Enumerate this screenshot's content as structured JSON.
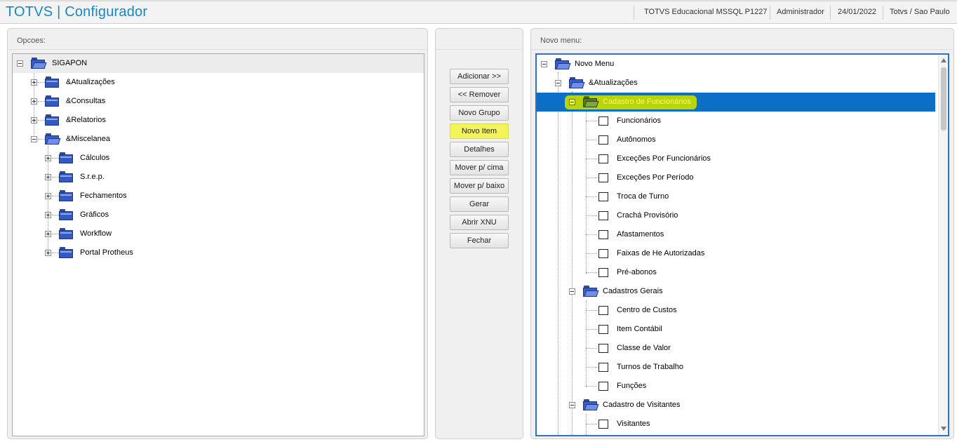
{
  "header": {
    "title": "TOTVS | Configurador",
    "environment": "TOTVS Educacional MSSQL P1227",
    "user": "Administrador",
    "date": "24/01/2022",
    "branch": "Totvs / Sao Paulo"
  },
  "left_panel": {
    "title": "Opcoes:",
    "root": "SIGAPON",
    "items": [
      "&Atualizações",
      "&Consultas",
      "&Relatorios",
      "&Miscelanea"
    ],
    "misc_children": [
      "Cálculos",
      "S.r.e.p.",
      "Fechamentos",
      "Gráficos",
      "Workflow",
      "Portal Protheus"
    ]
  },
  "buttons": {
    "adicionar": "Adicionar >>",
    "remover": "<< Remover",
    "novo_grupo": "Novo Grupo",
    "novo_item": "Novo Item",
    "detalhes": "Detalhes",
    "mover_cima": "Mover p/ cima",
    "mover_baixo": "Mover p/ baixo",
    "gerar": "Gerar",
    "abrir_xnu": "Abrir XNU",
    "fechar": "Fechar"
  },
  "right_panel": {
    "title": "Novo menu:",
    "root": "Novo Menu",
    "atualizacoes": "&Atualizações",
    "group1": {
      "label": "Cadastro de Funcionários",
      "items": [
        "Funcionários",
        "Autônomos",
        "Exceções Por Funcionários",
        "Exceções Por Período",
        "Troca de Turno",
        "Crachá Provisório",
        "Afastamentos",
        "Faixas de He Autorizadas",
        "Pré-abonos"
      ]
    },
    "group2": {
      "label": "Cadastros Gerais",
      "items": [
        "Centro de Custos",
        "Item Contábil",
        "Classe de Valor",
        "Turnos de Trabalho",
        "Funções"
      ]
    },
    "group3": {
      "label": "Cadastro de Visitantes",
      "items": [
        "Visitantes"
      ]
    }
  },
  "colors": {
    "brand": "#1a87c2",
    "selection": "#0b6fc7",
    "highlight": "#f2f45a"
  }
}
